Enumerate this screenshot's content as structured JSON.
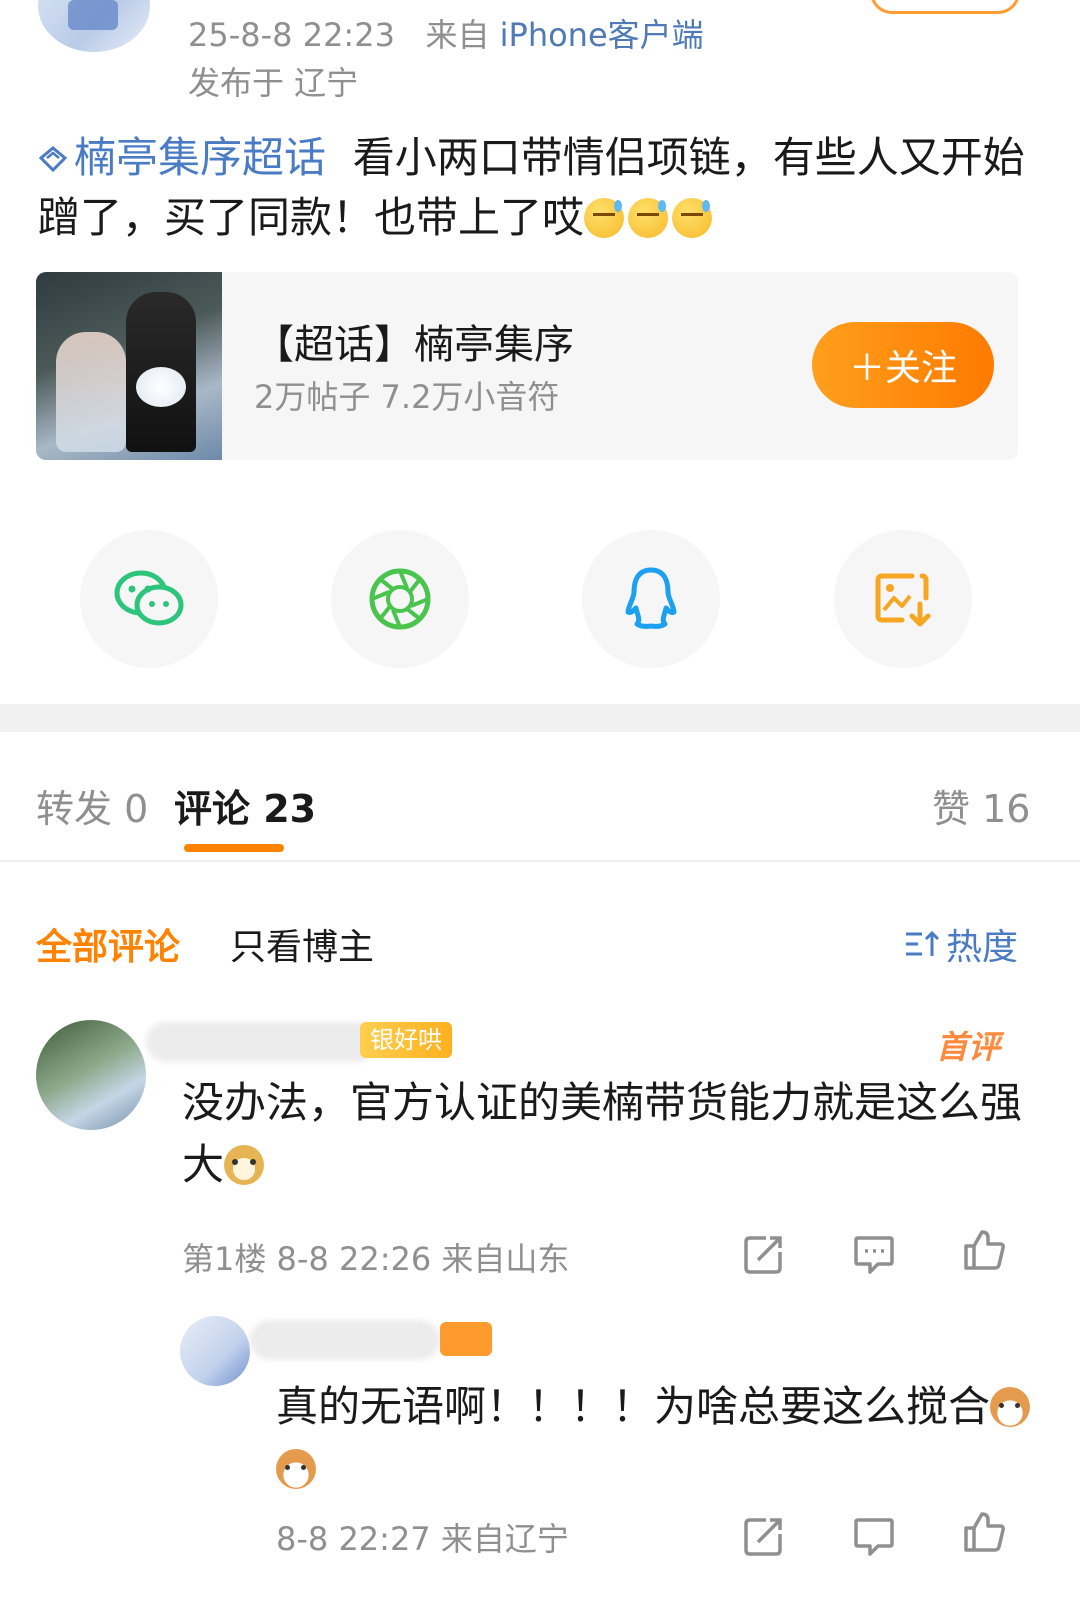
{
  "post": {
    "time": "25-8-8 22:23",
    "from_prefix": "来自",
    "source": "iPhone客户端",
    "location": "发布于 辽宁",
    "topic": "楠亭集序超话",
    "text": "看小两口带情侣项链，有些人又开始蹭了，买了同款！也带上了哎",
    "emoji": [
      "sweat-face",
      "sweat-face",
      "sweat-face"
    ]
  },
  "topic_card": {
    "title": "【超话】楠亭集序",
    "stats": "2万帖子 7.2万小音符",
    "follow_label": "＋关注"
  },
  "share": [
    "wechat-icon",
    "moments-icon",
    "qq-icon",
    "save-image-icon"
  ],
  "tabs": {
    "repost": "转发 0",
    "comments": "评论 23",
    "likes": "赞 16"
  },
  "filters": {
    "all": "全部评论",
    "author_only": "只看博主",
    "sort": "热度"
  },
  "comments": [
    {
      "badge": "银好哄",
      "first_tag": "首评",
      "text": "没办法，官方认证的美楠带货能力就是这么强大",
      "meta": "第1楼  8-8 22:26  来自山东"
    },
    {
      "text": "真的无语啊！！！！为啥总要这么搅合",
      "meta": "8-8 22:27  来自辽宁"
    }
  ],
  "colors": {
    "accent": "#ff8200",
    "link": "#4a7bc5",
    "meta": "#8f8f8f",
    "wechat": "#2dc47c",
    "qq": "#1ea0f0",
    "save": "#f5a623"
  }
}
